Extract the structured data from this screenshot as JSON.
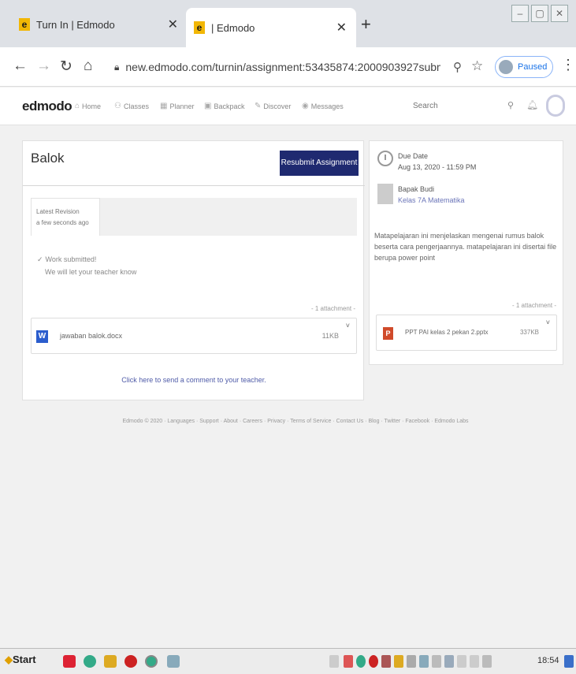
{
  "browser": {
    "tabs": [
      {
        "label": "Turn In | Edmodo",
        "favicon": "e"
      },
      {
        "label": "| Edmodo",
        "favicon": "e"
      }
    ],
    "url": "new.edmodo.com/turnin/assignment:53435874:2000903927submit...",
    "paused_label": "Paused"
  },
  "edmodo": {
    "logo": "edmodo",
    "nav": [
      "Home",
      "Classes",
      "Planner",
      "Backpack",
      "Discover",
      "Messages"
    ],
    "search_placeholder": "Search"
  },
  "assignment": {
    "title": "Balok",
    "resubmit_label": "Resubmit Assignment",
    "revision_label": "Latest Revision",
    "revision_time": "a few seconds ago",
    "submitted_title": "Work submitted!",
    "submitted_sub": "We will let your teacher know",
    "attachment_count": "- 1 attachment -",
    "attachment": {
      "name": "jawaban balok.docx",
      "size": "11KB",
      "icon": "word-icon"
    },
    "comment_link": "Click here to send a comment to your teacher."
  },
  "details": {
    "due_label": "Due Date",
    "due_date": "Aug 13, 2020 - 11:59 PM",
    "teacher": "Bapak Budi",
    "class": "Kelas 7A Matematika",
    "description": "Matapelajaran ini menjelaskan mengenai rumus balok beserta cara pengerjaannya. matapelajaran ini disertai file berupa power point",
    "attachment_count": "- 1 attachment -",
    "attachment": {
      "name": "PPT PAI kelas 2 pekan 2.pptx",
      "size": "337KB",
      "icon": "ppt-icon"
    }
  },
  "footer": "Edmodo © 2020 · Languages · Support · About · Careers · Privacy · Terms of Service · Contact Us · Blog · Twitter · Facebook · Edmodo Labs",
  "taskbar": {
    "start": "Start",
    "time": "18:54"
  }
}
